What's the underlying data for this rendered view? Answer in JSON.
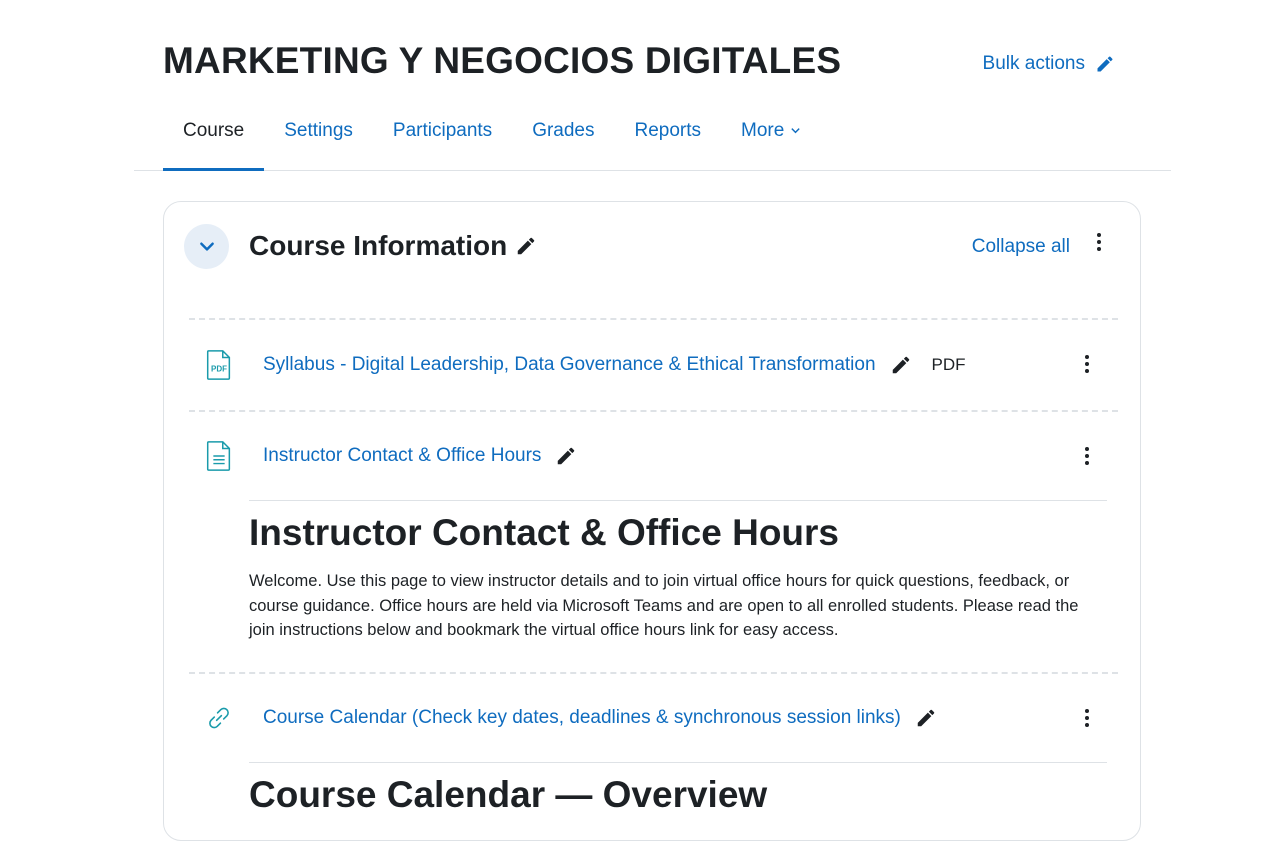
{
  "course": {
    "title": "MARKETING Y NEGOCIOS DIGITALES"
  },
  "header": {
    "bulk_actions_label": "Bulk actions"
  },
  "tabs": [
    {
      "label": "Course",
      "active": true
    },
    {
      "label": "Settings"
    },
    {
      "label": "Participants"
    },
    {
      "label": "Grades"
    },
    {
      "label": "Reports"
    },
    {
      "label": "More"
    }
  ],
  "section": {
    "title": "Course Information",
    "collapse_all_label": "Collapse all"
  },
  "activities": [
    {
      "icon": "pdf-icon",
      "title": "Syllabus - Digital Leadership, Data Governance & Ethical Transformation",
      "badge": "PDF"
    },
    {
      "icon": "page-document-icon",
      "title": "Instructor Contact & Office Hours",
      "description_heading": "Instructor Contact & Office Hours",
      "description_text": "Welcome. Use this page to view instructor details and to join virtual office hours for quick questions, feedback, or course guidance. Office hours are held via Microsoft Teams and are open to all enrolled students. Please read the join instructions below and bookmark the virtual office hours link for easy access."
    },
    {
      "icon": "link-icon",
      "title": "Course Calendar (Check key dates, deadlines & synchronous session links)",
      "description_heading": "Course Calendar — Overview"
    }
  ],
  "colors": {
    "link": "#0f6cbf",
    "text": "#1d2125",
    "activity_icon": "#1a9bab",
    "border": "#dee2e6",
    "collapse_bg": "#e6eef7"
  }
}
